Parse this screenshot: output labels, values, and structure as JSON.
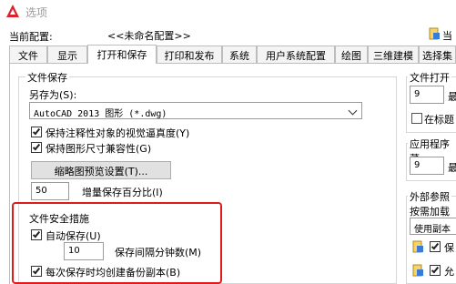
{
  "window": {
    "title": "选项",
    "icon": "autocad-a-icon",
    "accent": "#d9232e"
  },
  "config": {
    "label": "当前配置:",
    "value": "<<未命名配置>>",
    "side_label": "当"
  },
  "tabs": [
    {
      "label": "文件"
    },
    {
      "label": "显示"
    },
    {
      "label": "打开和保存",
      "active": true
    },
    {
      "label": "打印和发布"
    },
    {
      "label": "系统"
    },
    {
      "label": "用户系统配置"
    },
    {
      "label": "绘图"
    },
    {
      "label": "三维建模"
    },
    {
      "label": "选择集"
    }
  ],
  "file_save": {
    "title": "文件保存",
    "save_as_label": "另存为(S):",
    "save_as_value": "AutoCAD 2013 图形 (*.dwg)",
    "cb_visual_fidelity": {
      "label": "保持注释性对象的视觉逼真度(Y)",
      "checked": true
    },
    "cb_size_compat": {
      "label": "保持图形尺寸兼容性(G)",
      "checked": true
    },
    "thumbnail_button": "缩略图预览设置(T)...",
    "incremental_value": "50",
    "incremental_label": "增量保存百分比(I)"
  },
  "file_safety": {
    "title": "文件安全措施",
    "autosave": {
      "label": "自动保存(U)",
      "checked": true
    },
    "interval_value": "10",
    "interval_label": "保存间隔分钟数(M)",
    "backup": {
      "label": "每次保存时均创建备份副本(B)",
      "checked": true
    },
    "highlight_color": "#e01b1b"
  },
  "file_open": {
    "title": "文件打开",
    "recent_value": "9",
    "recent_label_cut": "最",
    "title_bar_cb_label": "在标题"
  },
  "app_menu": {
    "title": "应用程序菜",
    "recent_value": "9",
    "recent_label_cut": "最"
  },
  "xref": {
    "title": "外部参照",
    "load_label": "按需加载外",
    "combo_value": "使用副本",
    "cb1_label": "保",
    "cb2_label": "允"
  }
}
